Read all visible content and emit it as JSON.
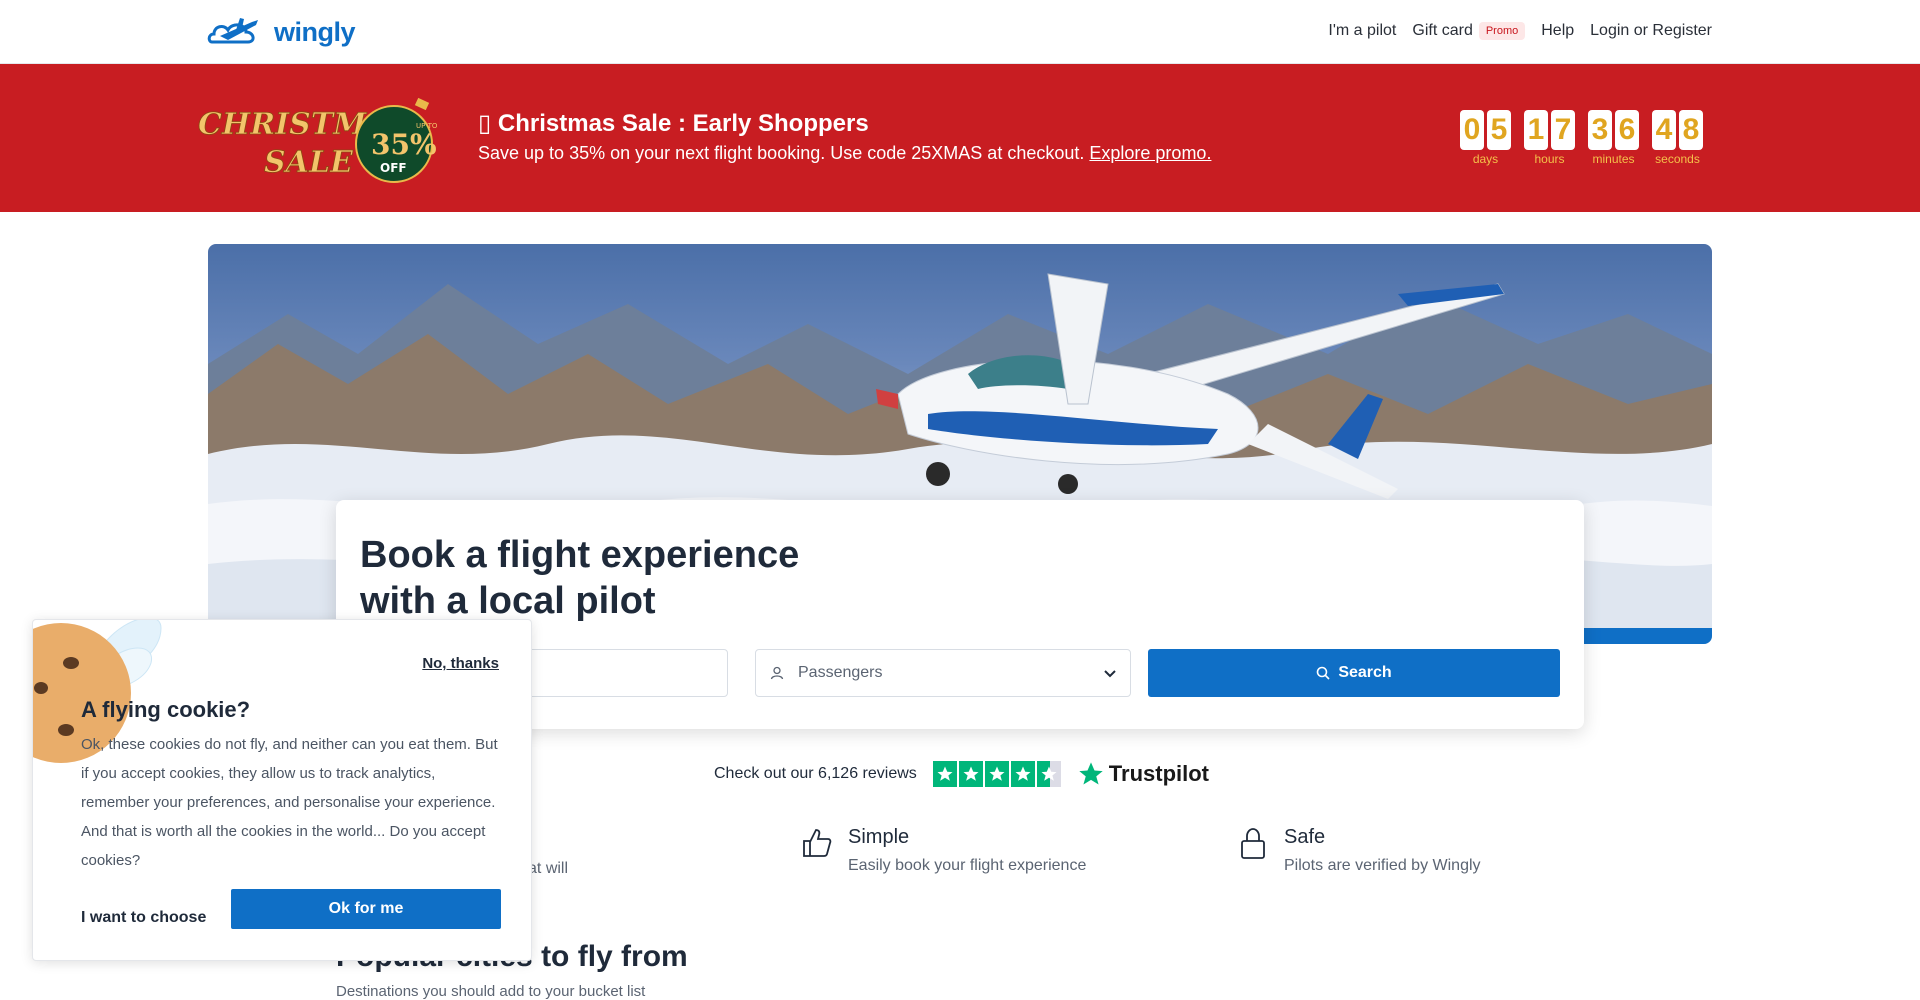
{
  "header": {
    "logo_text": "wingly",
    "nav": {
      "pilot": "I'm a pilot",
      "gift_card": "Gift card",
      "promo_badge": "Promo",
      "help": "Help",
      "login": "Login or Register"
    }
  },
  "banner": {
    "logo_line1": "CHRISTMAS",
    "logo_line2": "SALE",
    "logo_badge_small": "UP TO",
    "logo_badge_pct": "35%",
    "logo_badge_off": "OFF",
    "title_icon": "▯",
    "title": "Christmas Sale : Early Shoppers",
    "subtitle": "Save up to 35% on your next flight booking. Use code 25XMAS at checkout.",
    "link": "Explore promo.",
    "countdown": {
      "days": [
        "0",
        "5"
      ],
      "hours": [
        "1",
        "7"
      ],
      "minutes": [
        "3",
        "6"
      ],
      "seconds": [
        "4",
        "8"
      ],
      "labels": {
        "days": "days",
        "hours": "hours",
        "minutes": "minutes",
        "seconds": "seconds"
      }
    }
  },
  "booking": {
    "title_line1": "Book a flight experience",
    "title_line2": "with a local pilot",
    "passengers_placeholder": "Passengers",
    "search_label": "Search"
  },
  "trustpilot": {
    "text": "Check out our 6,126 reviews",
    "brand": "Trustpilot",
    "rating_stars": 4.5
  },
  "features": [
    {
      "title": "",
      "desc": "memories that will"
    },
    {
      "title": "Simple",
      "desc": "Easily book your flight experience",
      "icon": "thumbs-up-icon"
    },
    {
      "title": "Safe",
      "desc": "Pilots are verified by Wingly",
      "icon": "lock-icon"
    }
  ],
  "popular": {
    "title": "Popular cities to fly from",
    "subtitle": "Destinations you should add to your bucket list"
  },
  "cookie": {
    "no_thanks": "No, thanks",
    "title": "A flying cookie?",
    "text": "Ok, these cookies do not fly, and neither can you eat them. But if you accept cookies, they allow us to track analytics, remember your preferences, and personalise your experience. And that is worth all the cookies in the world... Do you accept cookies?",
    "choose": "I want to choose",
    "ok": "Ok for me"
  },
  "colors": {
    "brand_blue": "#0f6fc6",
    "banner_red": "#c81d22",
    "countdown_gold": "#e0a520",
    "trustpilot_green": "#00b67a"
  }
}
